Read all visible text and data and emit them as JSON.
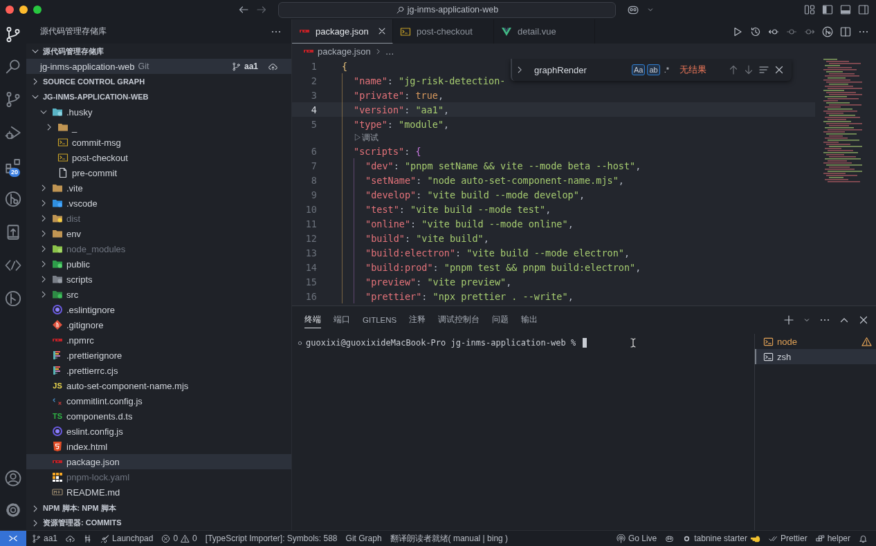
{
  "title_bar": {
    "search": "jg-inms-application-web"
  },
  "activity_bar": {
    "items": [
      {
        "selected": true
      },
      {
        "selected": false
      },
      {
        "selected": false
      },
      {
        "selected": false
      },
      {
        "selected": false,
        "badge": "20"
      },
      {
        "selected": false
      },
      {
        "selected": false
      },
      {
        "selected": false
      },
      {
        "selected": false
      }
    ]
  },
  "sidebar": {
    "title": "源代码管理存储库",
    "repositories": {
      "title": "源代码管理存储库",
      "expanded": true,
      "items": [
        {
          "name": "jg-inms-application-web",
          "provider": "Git",
          "branch": "aa1",
          "selected": true
        }
      ]
    },
    "graph_section": {
      "title": "SOURCE CONTROL GRAPH",
      "expanded": false
    },
    "explorer": {
      "title": "JG-INMS-APPLICATION-WEB",
      "expanded": true,
      "tree": [
        {
          "label": ".husky",
          "expanded": true,
          "ignored": false,
          "selected": false,
          "children": [
            {
              "label": "_",
              "expanded": false,
              "ignored": false,
              "selected": false
            },
            {
              "label": "commit-msg",
              "ignored": false,
              "selected": false
            },
            {
              "label": "post-checkout",
              "ignored": false,
              "selected": false
            },
            {
              "label": "pre-commit",
              "ignored": false,
              "selected": false
            }
          ]
        },
        {
          "label": ".vite",
          "expanded": false,
          "ignored": false,
          "selected": false
        },
        {
          "label": ".vscode",
          "expanded": false,
          "ignored": false,
          "selected": false
        },
        {
          "label": "dist",
          "expanded": false,
          "ignored": true,
          "selected": false
        },
        {
          "label": "env",
          "expanded": false,
          "ignored": false,
          "selected": false
        },
        {
          "label": "node_modules",
          "expanded": false,
          "ignored": true,
          "selected": false
        },
        {
          "label": "public",
          "expanded": false,
          "ignored": false,
          "selected": false
        },
        {
          "label": "scripts",
          "expanded": false,
          "ignored": false,
          "selected": false
        },
        {
          "label": "src",
          "expanded": false,
          "ignored": false,
          "selected": false
        },
        {
          "label": ".eslintignore",
          "ignored": false,
          "selected": false
        },
        {
          "label": ".gitignore",
          "ignored": false,
          "selected": false
        },
        {
          "label": ".npmrc",
          "ignored": false,
          "selected": false
        },
        {
          "label": ".prettierignore",
          "ignored": false,
          "selected": false
        },
        {
          "label": ".prettierrc.cjs",
          "ignored": false,
          "selected": false
        },
        {
          "label": "auto-set-component-name.mjs",
          "icon_text": "JS",
          "ignored": false,
          "selected": false
        },
        {
          "label": "commitlint.config.js",
          "ignored": false,
          "selected": false
        },
        {
          "label": "components.d.ts",
          "icon_text": "TS",
          "ignored": false,
          "selected": false
        },
        {
          "label": "eslint.config.js",
          "ignored": false,
          "selected": false
        },
        {
          "label": "index.html",
          "ignored": false,
          "selected": false
        },
        {
          "label": "package.json",
          "ignored": false,
          "selected": true
        },
        {
          "label": "pnpm-lock.yaml",
          "ignored": true,
          "selected": false
        },
        {
          "label": "README.md",
          "ignored": false,
          "selected": false
        }
      ]
    },
    "bottom_sections": [
      {
        "title": "NPM 脚本: NPM 脚本",
        "expanded": false
      },
      {
        "title": "资源管理器: COMMITS",
        "expanded": false
      }
    ]
  },
  "editor": {
    "tabs": [
      {
        "label": "package.json",
        "selected": true
      },
      {
        "label": "post-checkout",
        "selected": false
      },
      {
        "label": "detail.vue",
        "selected": false
      }
    ],
    "breadcrumb": {
      "file": "package.json",
      "rest": "…"
    },
    "lines": [
      {
        "kind": "code",
        "number": "1",
        "current": false,
        "tokens": [
          {
            "kind": "brace",
            "text": "{"
          }
        ],
        "children": [
          {
            "kind": "code",
            "number": "2",
            "current": false,
            "tokens": [
              {
                "kind": "key",
                "text": "\"name\""
              },
              {
                "kind": "punct",
                "text": ": "
              },
              {
                "kind": "string",
                "text": "\"jg-risk-detection-"
              }
            ]
          },
          {
            "kind": "code",
            "number": "3",
            "current": false,
            "tokens": [
              {
                "kind": "key",
                "text": "\"private\""
              },
              {
                "kind": "punct",
                "text": ": "
              },
              {
                "kind": "bool",
                "text": "true"
              },
              {
                "kind": "punct",
                "text": ","
              }
            ]
          },
          {
            "kind": "code",
            "number": "4",
            "current": true,
            "tokens": [
              {
                "kind": "key",
                "text": "\"version\""
              },
              {
                "kind": "punct",
                "text": ": "
              },
              {
                "kind": "string",
                "text": "\"aa1\""
              },
              {
                "kind": "punct",
                "text": ","
              }
            ]
          },
          {
            "kind": "code",
            "number": "5",
            "current": false,
            "tokens": [
              {
                "kind": "key",
                "text": "\"type\""
              },
              {
                "kind": "punct",
                "text": ": "
              },
              {
                "kind": "string",
                "text": "\"module\""
              },
              {
                "kind": "punct",
                "text": ","
              }
            ]
          },
          {
            "kind": "codelens",
            "text": "▷调试"
          },
          {
            "kind": "code",
            "number": "6",
            "current": false,
            "tokens": [
              {
                "kind": "key",
                "text": "\"scripts\""
              },
              {
                "kind": "punct",
                "text": ": "
              },
              {
                "kind": "brace2",
                "text": "{"
              }
            ],
            "children": [
              {
                "kind": "code",
                "number": "7",
                "current": false,
                "tokens": [
                  {
                    "kind": "key",
                    "text": "\"dev\""
                  },
                  {
                    "kind": "punct",
                    "text": ": "
                  },
                  {
                    "kind": "string",
                    "text": "\"pnpm setName && vite --mode beta --host\""
                  },
                  {
                    "kind": "punct",
                    "text": ","
                  }
                ]
              },
              {
                "kind": "code",
                "number": "8",
                "current": false,
                "tokens": [
                  {
                    "kind": "key",
                    "text": "\"setName\""
                  },
                  {
                    "kind": "punct",
                    "text": ": "
                  },
                  {
                    "kind": "string",
                    "text": "\"node auto-set-component-name.mjs\""
                  },
                  {
                    "kind": "punct",
                    "text": ","
                  }
                ]
              },
              {
                "kind": "code",
                "number": "9",
                "current": false,
                "tokens": [
                  {
                    "kind": "key",
                    "text": "\"develop\""
                  },
                  {
                    "kind": "punct",
                    "text": ": "
                  },
                  {
                    "kind": "string",
                    "text": "\"vite build --mode develop\""
                  },
                  {
                    "kind": "punct",
                    "text": ","
                  }
                ]
              },
              {
                "kind": "code",
                "number": "10",
                "current": false,
                "tokens": [
                  {
                    "kind": "key",
                    "text": "\"test\""
                  },
                  {
                    "kind": "punct",
                    "text": ": "
                  },
                  {
                    "kind": "string",
                    "text": "\"vite build --mode test\""
                  },
                  {
                    "kind": "punct",
                    "text": ","
                  }
                ]
              },
              {
                "kind": "code",
                "number": "11",
                "current": false,
                "tokens": [
                  {
                    "kind": "key",
                    "text": "\"online\""
                  },
                  {
                    "kind": "punct",
                    "text": ": "
                  },
                  {
                    "kind": "string",
                    "text": "\"vite build --mode online\""
                  },
                  {
                    "kind": "punct",
                    "text": ","
                  }
                ]
              },
              {
                "kind": "code",
                "number": "12",
                "current": false,
                "tokens": [
                  {
                    "kind": "key",
                    "text": "\"build\""
                  },
                  {
                    "kind": "punct",
                    "text": ": "
                  },
                  {
                    "kind": "string",
                    "text": "\"vite build\""
                  },
                  {
                    "kind": "punct",
                    "text": ","
                  }
                ]
              },
              {
                "kind": "code",
                "number": "13",
                "current": false,
                "tokens": [
                  {
                    "kind": "key",
                    "text": "\"build:electron\""
                  },
                  {
                    "kind": "punct",
                    "text": ": "
                  },
                  {
                    "kind": "string",
                    "text": "\"vite build --mode electron\""
                  },
                  {
                    "kind": "punct",
                    "text": ","
                  }
                ]
              },
              {
                "kind": "code",
                "number": "14",
                "current": false,
                "tokens": [
                  {
                    "kind": "key",
                    "text": "\"build:prod\""
                  },
                  {
                    "kind": "punct",
                    "text": ": "
                  },
                  {
                    "kind": "string",
                    "text": "\"pnpm test && pnpm build:electron\""
                  },
                  {
                    "kind": "punct",
                    "text": ","
                  }
                ]
              },
              {
                "kind": "code",
                "number": "15",
                "current": false,
                "tokens": [
                  {
                    "kind": "key",
                    "text": "\"preview\""
                  },
                  {
                    "kind": "punct",
                    "text": ": "
                  },
                  {
                    "kind": "string",
                    "text": "\"vite preview\""
                  },
                  {
                    "kind": "punct",
                    "text": ","
                  }
                ]
              },
              {
                "kind": "code",
                "number": "16",
                "current": false,
                "tokens": [
                  {
                    "kind": "key",
                    "text": "\"prettier\""
                  },
                  {
                    "kind": "punct",
                    "text": ": "
                  },
                  {
                    "kind": "string",
                    "text": "\"npx prettier . --write\""
                  },
                  {
                    "kind": "punct",
                    "text": ","
                  }
                ]
              }
            ]
          }
        ]
      }
    ],
    "find": {
      "query": "graphRender",
      "toggles": [
        {
          "label": "Aa",
          "selected": true
        },
        {
          "label": "ab",
          "selected": true
        },
        {
          "label": ".*",
          "selected": false
        }
      ],
      "result": "无结果"
    }
  },
  "panel": {
    "tabs": [
      {
        "label": "终端",
        "selected": true
      },
      {
        "label": "端口",
        "selected": false
      },
      {
        "label": "GITLENS",
        "selected": false
      },
      {
        "label": "注释",
        "selected": false
      },
      {
        "label": "调试控制台",
        "selected": false
      },
      {
        "label": "问题",
        "selected": false
      },
      {
        "label": "输出",
        "selected": false
      }
    ],
    "terminal": {
      "prompt": "guoxixi@guoxixideMacBook-Pro jg-inms-application-web % "
    },
    "terminals": [
      {
        "label": "node",
        "warning": true,
        "selected": false
      },
      {
        "label": "zsh",
        "warning": false,
        "selected": true
      }
    ]
  },
  "status_bar": {
    "left": [
      {
        "kind": "remote"
      },
      {
        "kind": "item",
        "text": "aa1"
      },
      {
        "kind": "item"
      },
      {
        "kind": "item"
      },
      {
        "kind": "item",
        "text": "Launchpad"
      },
      {
        "kind": "problems",
        "errors": "0",
        "warnings": "0"
      },
      {
        "kind": "item",
        "text": "[TypeScript Importer]: Symbols: 588"
      },
      {
        "kind": "item",
        "text": "Git Graph"
      },
      {
        "kind": "item",
        "text": "翻译朗读者就绪( manual | bing )"
      }
    ],
    "right": [
      {
        "kind": "item",
        "text": "Go Live"
      },
      {
        "kind": "item"
      },
      {
        "kind": "item",
        "text": "tabnine starter"
      },
      {
        "kind": "item",
        "text": "Prettier"
      },
      {
        "kind": "item",
        "text": "helper"
      },
      {
        "kind": "item"
      }
    ]
  }
}
